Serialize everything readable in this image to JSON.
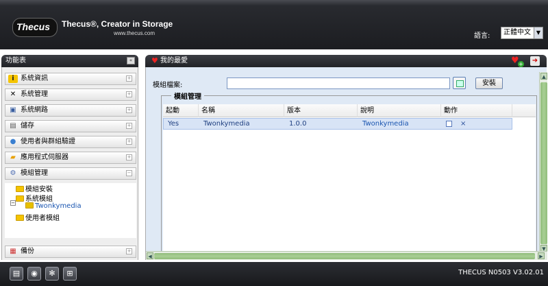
{
  "header": {
    "logo": "Thecus",
    "tagline": "Thecus®, Creator in Storage",
    "site": "www.thecus.com",
    "language_label": "語言:",
    "language_value": "正體中文"
  },
  "sidebar": {
    "title": "功能表",
    "items": [
      {
        "label": "系統資訊",
        "icon": "info-icon"
      },
      {
        "label": "系統管理",
        "icon": "tools-icon"
      },
      {
        "label": "系統網路",
        "icon": "network-icon"
      },
      {
        "label": "儲存",
        "icon": "storage-icon"
      },
      {
        "label": "使用者與群組驗證",
        "icon": "users-icon"
      },
      {
        "label": "應用程式伺服器",
        "icon": "app-server-icon"
      },
      {
        "label": "模組管理",
        "icon": "modules-icon"
      }
    ],
    "tree": {
      "module_install": "模組安裝",
      "system_modules": "系統模組",
      "twonkymedia": "Twonkymedia",
      "user_modules": "使用者模組"
    },
    "backup": "備份"
  },
  "main": {
    "title": "我的最愛",
    "module_file_label": "模組檔案:",
    "install_label": "安裝",
    "section_title": "模組管理",
    "columns": [
      "起動",
      "名稱",
      "版本",
      "說明",
      "動作"
    ],
    "rows": [
      {
        "enabled": "Yes",
        "name": "Twonkymedia",
        "version": "1.0.0",
        "description": "Twonkymedia",
        "action_delete": "×"
      }
    ]
  },
  "footer": {
    "version": "THECUS N0503 V3.02.01"
  },
  "colors": {
    "header_bg": "#1c1d21",
    "panel_bg": "#dfe9f5",
    "selected_row": "#d8e4f6",
    "scrollbar": "#8fbc7a"
  }
}
